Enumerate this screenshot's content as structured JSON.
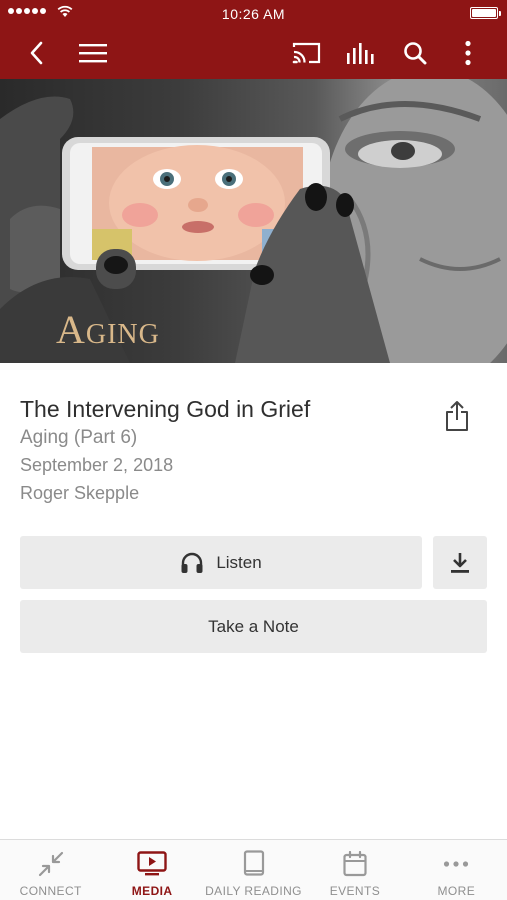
{
  "status_bar": {
    "time": "10:26 AM"
  },
  "header": {
    "back_icon": "chevron-left-icon",
    "menu_icon": "hamburger-icon",
    "cast_icon": "cast-icon",
    "audio_icon": "audio-bars-icon",
    "search_icon": "search-icon",
    "more_icon": "vertical-dots-icon",
    "bar_color": "#8e1515"
  },
  "hero": {
    "title": "Aging"
  },
  "media": {
    "title": "The Intervening God in Grief",
    "series": "Aging (Part 6)",
    "date": "September 2, 2018",
    "speaker": "Roger Skepple"
  },
  "actions": {
    "listen_label": "Listen",
    "note_label": "Take a Note",
    "download_icon": "download-icon",
    "share_icon": "share-icon"
  },
  "tabs": [
    {
      "label": "CONNECT",
      "icon": "connect-icon",
      "active": false
    },
    {
      "label": "MEDIA",
      "icon": "media-icon",
      "active": true
    },
    {
      "label": "DAILY READING",
      "icon": "book-icon",
      "active": false
    },
    {
      "label": "EVENTS",
      "icon": "calendar-icon",
      "active": false
    },
    {
      "label": "MORE",
      "icon": "more-dots-icon",
      "active": false
    }
  ],
  "colors": {
    "accent": "#8e1515",
    "button_bg": "#ebebeb",
    "secondary_text": "#8a8a8a"
  }
}
